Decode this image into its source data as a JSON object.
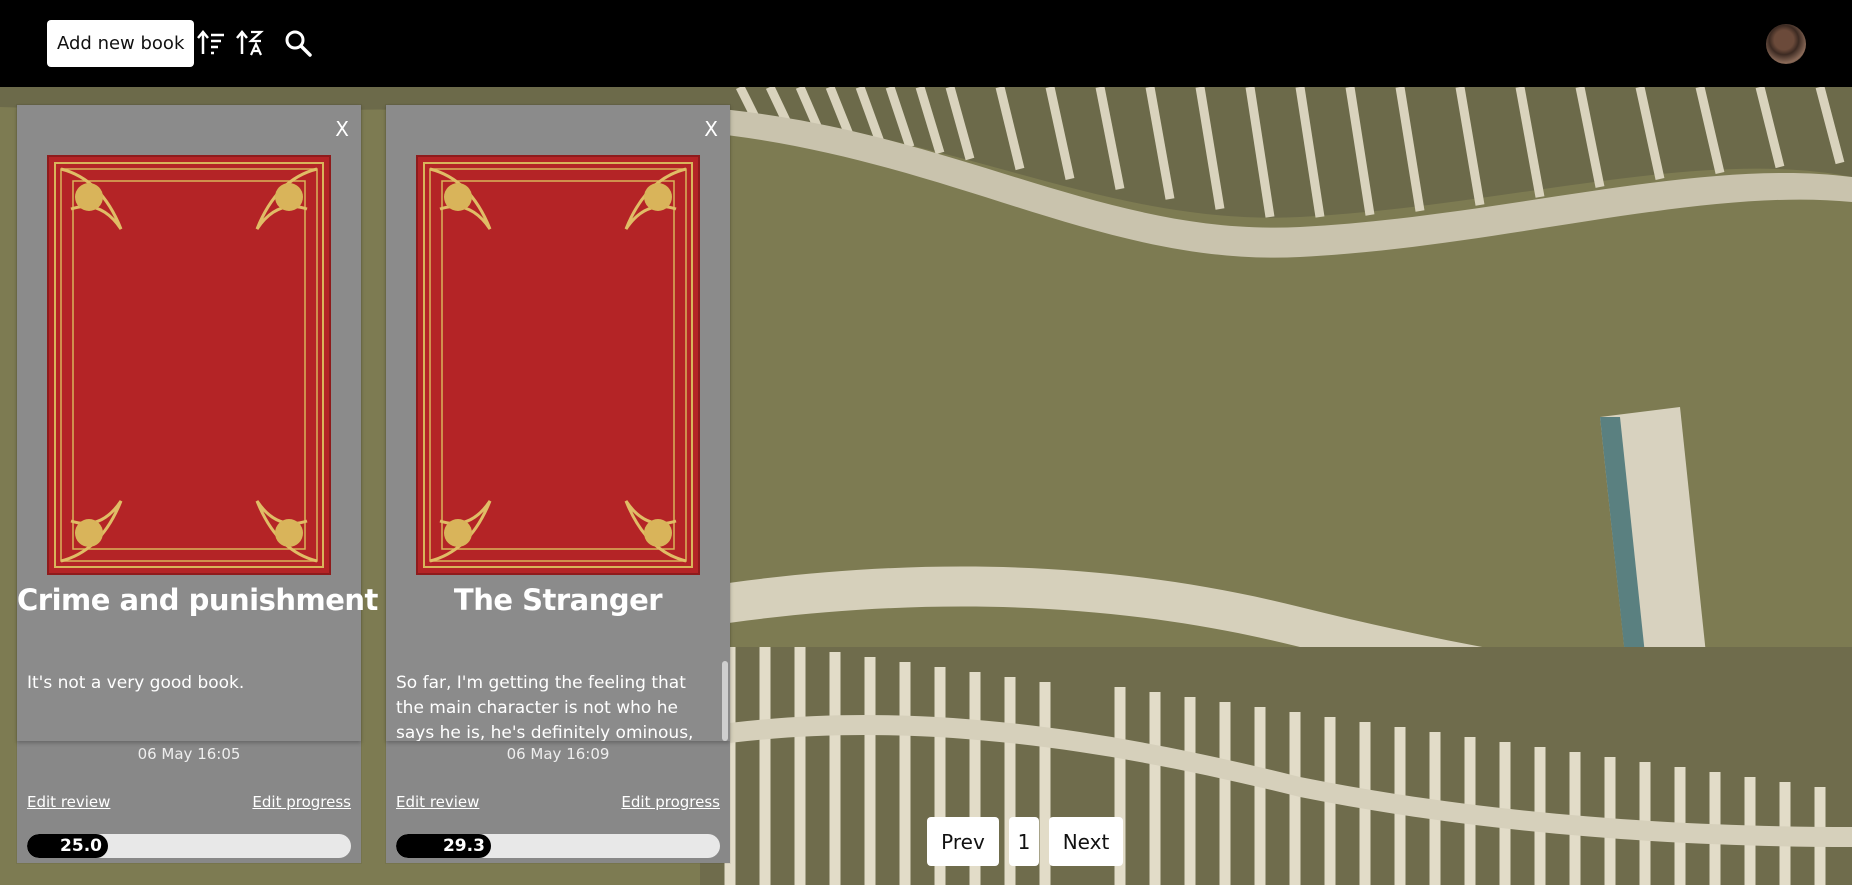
{
  "toolbar": {
    "add_label": "Add new book",
    "icons": [
      "sort-order-icon",
      "sort-alpha-icon",
      "search-icon"
    ]
  },
  "colors": {
    "topbar": "#000000",
    "card": "#8b8b8b",
    "cover": "#b42426",
    "ornament": "#d9b45a",
    "progress_fill": "#000000",
    "progress_track": "#e8e8e8"
  },
  "books": [
    {
      "title": "Crime and punishment",
      "review": "It's not a very good book.",
      "timestamp": "06 May 16:05",
      "edit_review": "Edit review",
      "edit_progress": "Edit progress",
      "progress_label": "25.0",
      "progress_percent": 25.0
    },
    {
      "title": "The Stranger",
      "review": "So far, I'm getting the feeling that the main character is not who he says he is, he's definitely ominous, but fails to",
      "timestamp": "06 May 16:09",
      "edit_review": "Edit review",
      "edit_progress": "Edit progress",
      "progress_label": "29.3",
      "progress_percent": 29.3
    }
  ],
  "pagination": {
    "prev": "Prev",
    "page": "1",
    "next": "Next"
  },
  "close_label": "X"
}
